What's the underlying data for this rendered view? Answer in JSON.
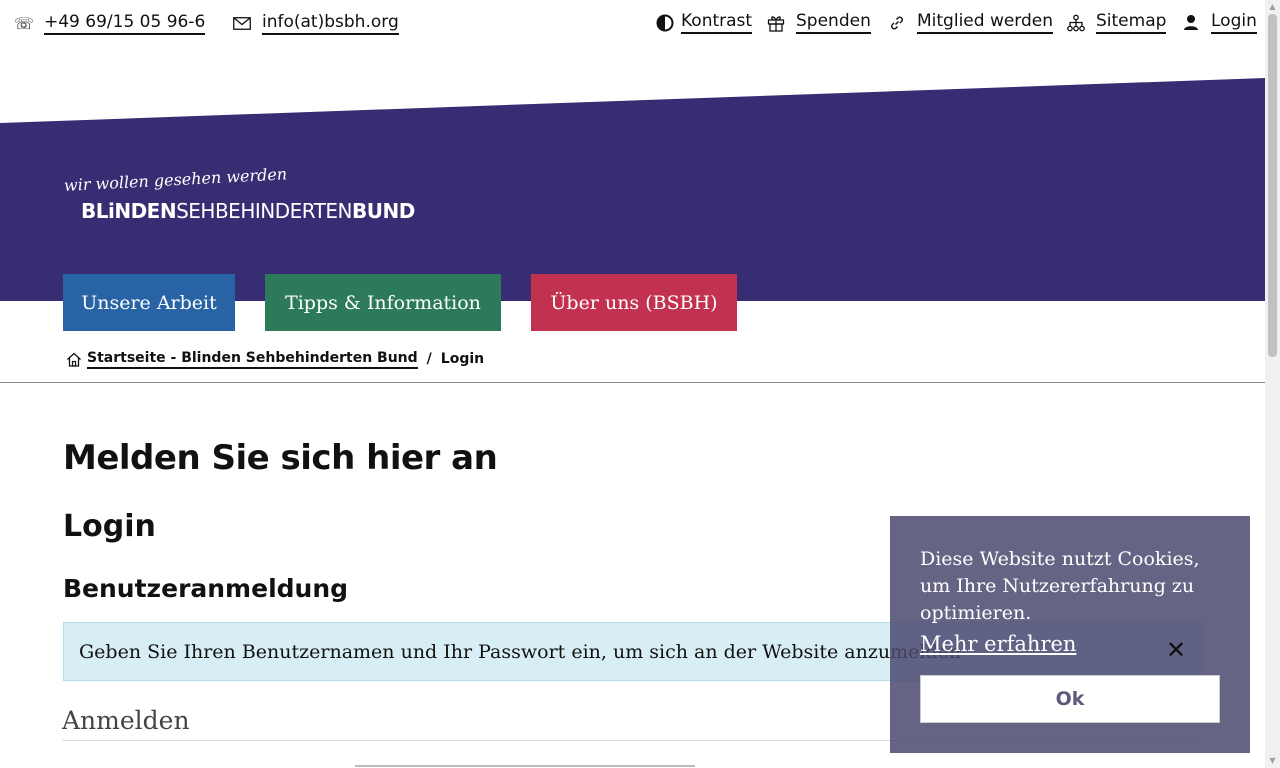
{
  "topbar": {
    "phone": {
      "label": "+49 69/15 05 96-6",
      "icon": "phone-icon"
    },
    "email": {
      "label": "info(at)bsbh.org",
      "icon": "envelope-icon"
    },
    "links": [
      {
        "label": "Kontrast",
        "icon": "contrast-icon"
      },
      {
        "label": "Spenden",
        "icon": "gift-icon"
      },
      {
        "label": "Mitglied werden",
        "icon": "link-icon"
      },
      {
        "label": "Sitemap",
        "icon": "sitemap-icon"
      },
      {
        "label": "Login",
        "icon": "user-icon"
      }
    ]
  },
  "logo": {
    "tagline": "wir wollen gesehen werden",
    "name_part1": "BLiNDEN",
    "name_part2": "SEHBEHINDERTEN",
    "name_part3": "BUND"
  },
  "nav": [
    {
      "label": "Unsere Arbeit",
      "color": "#2863a5"
    },
    {
      "label": "Tipps & Information",
      "color": "#2d7a5a"
    },
    {
      "label": "Über uns (BSBH)",
      "color": "#c2314f"
    }
  ],
  "breadcrumb": {
    "home_label": "Startseite - Blinden Sehbehinderten Bund",
    "separator": "/",
    "current": "Login"
  },
  "content": {
    "page_title": "Melden Sie sich hier an",
    "section_title": "Login",
    "subsection_title": "Benutzeranmeldung",
    "info_text": "Geben Sie Ihren Benutzernamen und Ihr Passwort ein, um sich an der Website anzumelden",
    "form_legend": "Anmelden"
  },
  "cookie": {
    "text": "Diese Website nutzt Cookies, um Ihre Nutzererfahrung zu optimieren.",
    "more_label": "Mehr erfahren",
    "ok_label": "Ok",
    "close_symbol": "✕"
  },
  "colors": {
    "banner": "#372d73",
    "nav_blue": "#2863a5",
    "nav_green": "#2d7a5a",
    "nav_red": "#c2314f",
    "info_bg": "#d8eef5",
    "cookie_bg": "#4b4970"
  }
}
